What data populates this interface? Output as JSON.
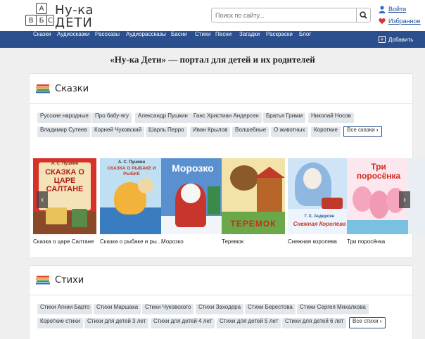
{
  "site": {
    "logo_line1": "Ну-ка",
    "logo_line2": "ДЕТИ",
    "logo_letters": [
      "А",
      "Б",
      "В",
      "С"
    ],
    "search_placeholder": "Поиск по сайту...",
    "login_label": "Войти",
    "favorites_label": "Избранное"
  },
  "nav": {
    "items": [
      "Сказки",
      "Аудиосказки",
      "Рассказы",
      "Аудиорассказы",
      "Басни",
      "Стихи",
      "Песни",
      "Загадки",
      "Раскраски",
      "Блог"
    ],
    "add_label": "Добавить"
  },
  "headline": "«Ну-ка Дети» — портал для детей и их родителей",
  "fairy_tales": {
    "title": "Сказки",
    "tags_row1": [
      "Русские народные",
      "Про бабу-ягу",
      "Александр Пушкин",
      "Ганс Христиан Андерсен",
      "Братья Гримм",
      "Николай Носов"
    ],
    "tags_row2": [
      "Владимир Сутеев",
      "Корней Чуковский",
      "Шарль Перро",
      "Иван Крылов",
      "Волшебные",
      "О животных",
      "Короткие"
    ],
    "all_label": "Все сказки",
    "books": [
      {
        "caption": "Сказка о царе Салтане",
        "cover_author": "А. С. Пушкин",
        "cover_title": "СКАЗКА О ЦАРЕ САЛТАНЕ"
      },
      {
        "caption": "Сказка о рыбаке и рыбке",
        "cover_author": "А. С. Пушкин",
        "cover_title": "СКАЗКА О РЫБАКЕ И РЫБКЕ"
      },
      {
        "caption": "Морозко",
        "cover_author": "",
        "cover_title": "Морозко"
      },
      {
        "caption": "Теремок",
        "cover_author": "",
        "cover_title": "ТЕРЕМОК"
      },
      {
        "caption": "Снежная королева",
        "cover_author": "Г. Х. Андерсен",
        "cover_title": "Снежная Королева"
      },
      {
        "caption": "Три поросёнка",
        "cover_author": "",
        "cover_title": "Три поросёнка"
      }
    ]
  },
  "poems": {
    "title": "Стихи",
    "tags_row1": [
      "Стихи Агнии Барто",
      "Стихи Маршака",
      "Стихи Чуковского",
      "Стихи Заходера",
      "Стихи Берестова",
      "Стихи Сергея Михалкова"
    ],
    "tags_row2": [
      "Короткие стихи",
      "Стихи для детей 3 лет",
      "Стихи для детей 4 лет",
      "Стихи для детей 5 лет",
      "Стихи для детей 6 лет"
    ],
    "all_label": "Все стихи"
  },
  "colors": {
    "nav_bg": "#2b4f8d",
    "tag_bg": "#e2e7ec",
    "heart": "#d9343b",
    "link": "#1f4f99"
  },
  "icons": {
    "search": "magnifier-icon",
    "login": "user-icon",
    "favorites": "heart-icon",
    "add": "plus-icon",
    "section": "books-stack-icon",
    "all": "chevron-right-icon"
  }
}
